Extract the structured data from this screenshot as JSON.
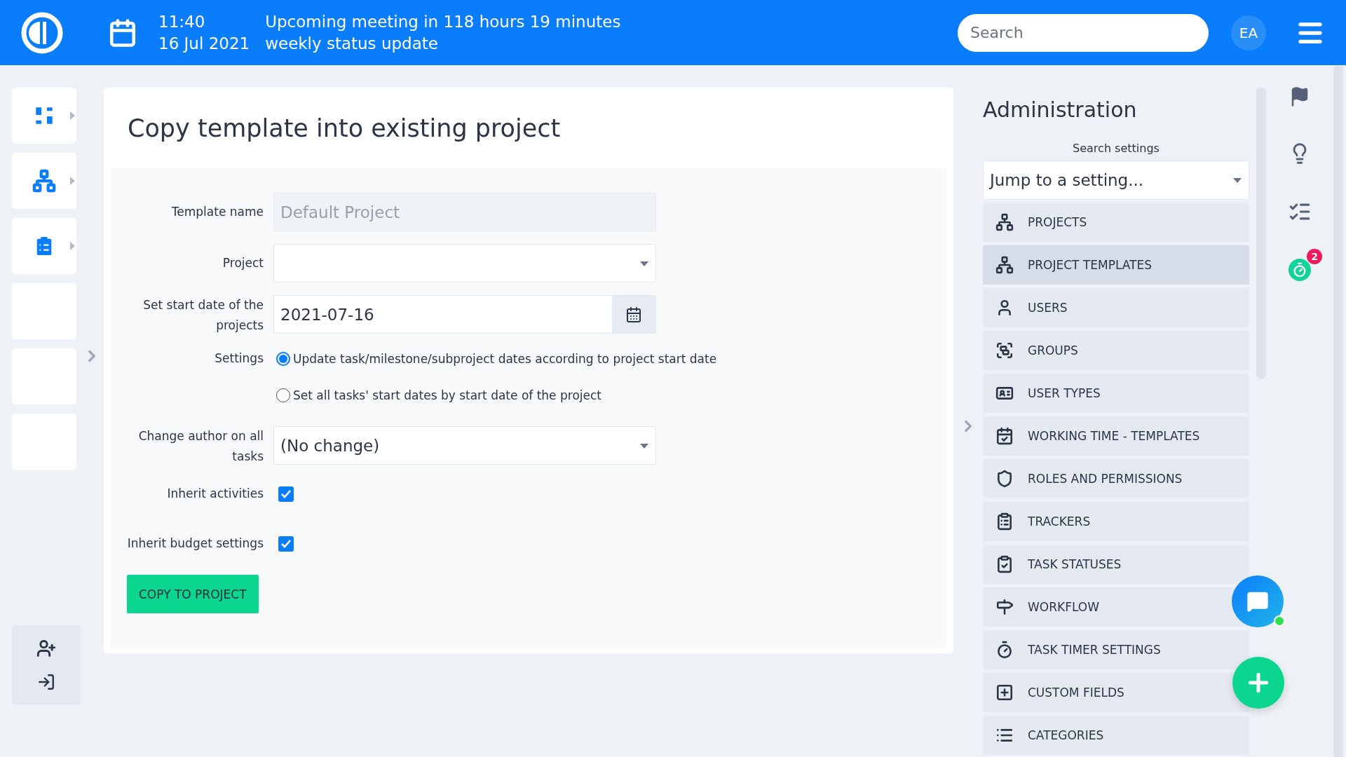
{
  "header": {
    "time": "11:40",
    "meeting": "Upcoming meeting in 118 hours 19 minutes",
    "date": "16 Jul 2021",
    "event": "weekly status update",
    "search": {
      "placeholder": "Search"
    },
    "avatar": "EA"
  },
  "sidebar": {
    "tiles": [
      {
        "has_icon": true
      },
      {
        "has_icon": true
      },
      {
        "has_icon": true
      },
      {
        "has_icon": false
      },
      {
        "has_icon": false
      },
      {
        "has_icon": false
      }
    ]
  },
  "page": {
    "title": "Copy template into existing project",
    "form": {
      "template_name": {
        "label": "Template name",
        "value": "Default Project",
        "disabled": true
      },
      "project": {
        "label": "Project"
      },
      "start_date": {
        "label": "Set start date of the projects",
        "value": "2021-07-16"
      },
      "settings": {
        "label": "Settings",
        "options": [
          {
            "label": "Update task/milestone/subproject dates according to project start date",
            "selected": true
          },
          {
            "label": "Set all tasks' start dates by start date of the project",
            "selected": false
          }
        ]
      },
      "author": {
        "label": "Change author on all tasks",
        "value": "(No change)"
      },
      "checkboxes": [
        {
          "label": "Inherit activities",
          "checked": true
        },
        {
          "label": "Inherit budget settings",
          "checked": true
        }
      ],
      "submit": "COPY TO PROJECT"
    }
  },
  "admin": {
    "title": "Administration",
    "search_label": "Search settings",
    "jump": {
      "placeholder": "Jump to a setting..."
    },
    "items": [
      {
        "label": "PROJECTS",
        "selected": false
      },
      {
        "label": "PROJECT TEMPLATES",
        "selected": true
      },
      {
        "label": "USERS",
        "selected": false
      },
      {
        "label": "GROUPS",
        "selected": false
      },
      {
        "label": "USER TYPES",
        "selected": false
      },
      {
        "label": "WORKING TIME - TEMPLATES",
        "selected": false
      },
      {
        "label": "ROLES AND PERMISSIONS",
        "selected": false
      },
      {
        "label": "TRACKERS",
        "selected": false
      },
      {
        "label": "TASK STATUSES",
        "selected": false
      },
      {
        "label": "WORKFLOW",
        "selected": false
      },
      {
        "label": "TASK TIMER SETTINGS",
        "selected": false
      },
      {
        "label": "CUSTOM FIELDS",
        "selected": false
      },
      {
        "label": "CATEGORIES",
        "selected": false
      }
    ]
  },
  "rail": {
    "timer_badge": "2"
  },
  "chat": {
    "online": true
  }
}
